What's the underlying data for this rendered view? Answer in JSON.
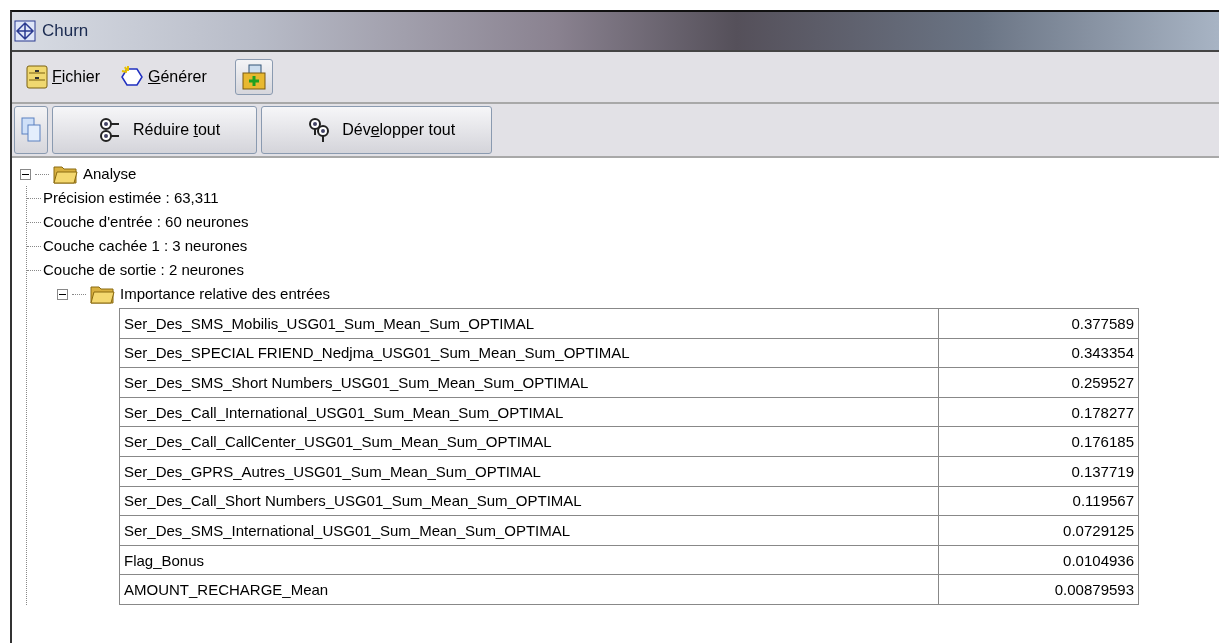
{
  "window": {
    "title": "Churn"
  },
  "menu": [
    {
      "key": "F",
      "after": "ichier",
      "kind": "menu"
    },
    {
      "key": "G",
      "after": "énérer",
      "kind": "menu"
    },
    {
      "kind": "icon-button"
    }
  ],
  "toolbar": [
    {
      "kind": "icon-button"
    },
    {
      "before": "Réduire ",
      "key": "t",
      "after": "out",
      "kind": "collapse"
    },
    {
      "before": "Dév",
      "key": "e",
      "after": "lopper tout",
      "kind": "expand"
    }
  ],
  "tree": [
    {
      "label": "Analyse",
      "expanded": true,
      "children": [
        {
          "label": "Précision estimée : 63,311"
        },
        {
          "label": "Couche d'entrée : 60 neurones"
        },
        {
          "label": "Couche cachée 1 : 3 neurones"
        },
        {
          "label": "Couche de sortie : 2 neurones"
        },
        {
          "label": "Importance relative des entrées",
          "expanded": true,
          "table": [
            [
              "Ser_Des_SMS_Mobilis_USG01_Sum_Mean_Sum_OPTIMAL",
              "0.377589"
            ],
            [
              "Ser_Des_SPECIAL FRIEND_Nedjma_USG01_Sum_Mean_Sum_OPTIMAL",
              "0.343354"
            ],
            [
              "Ser_Des_SMS_Short Numbers_USG01_Sum_Mean_Sum_OPTIMAL",
              "0.259527"
            ],
            [
              "Ser_Des_Call_International_USG01_Sum_Mean_Sum_OPTIMAL",
              "0.178277"
            ],
            [
              "Ser_Des_Call_CallCenter_USG01_Sum_Mean_Sum_OPTIMAL",
              "0.176185"
            ],
            [
              "Ser_Des_GPRS_Autres_USG01_Sum_Mean_Sum_OPTIMAL",
              "0.137719"
            ],
            [
              "Ser_Des_Call_Short Numbers_USG01_Sum_Mean_Sum_OPTIMAL",
              "0.119567"
            ],
            [
              "Ser_Des_SMS_International_USG01_Sum_Mean_Sum_OPTIMAL",
              "0.0729125"
            ],
            [
              "Flag_Bonus",
              "0.0104936"
            ],
            [
              "AMOUNT_RECHARGE_Mean",
              "0.00879593"
            ]
          ]
        }
      ]
    }
  ]
}
